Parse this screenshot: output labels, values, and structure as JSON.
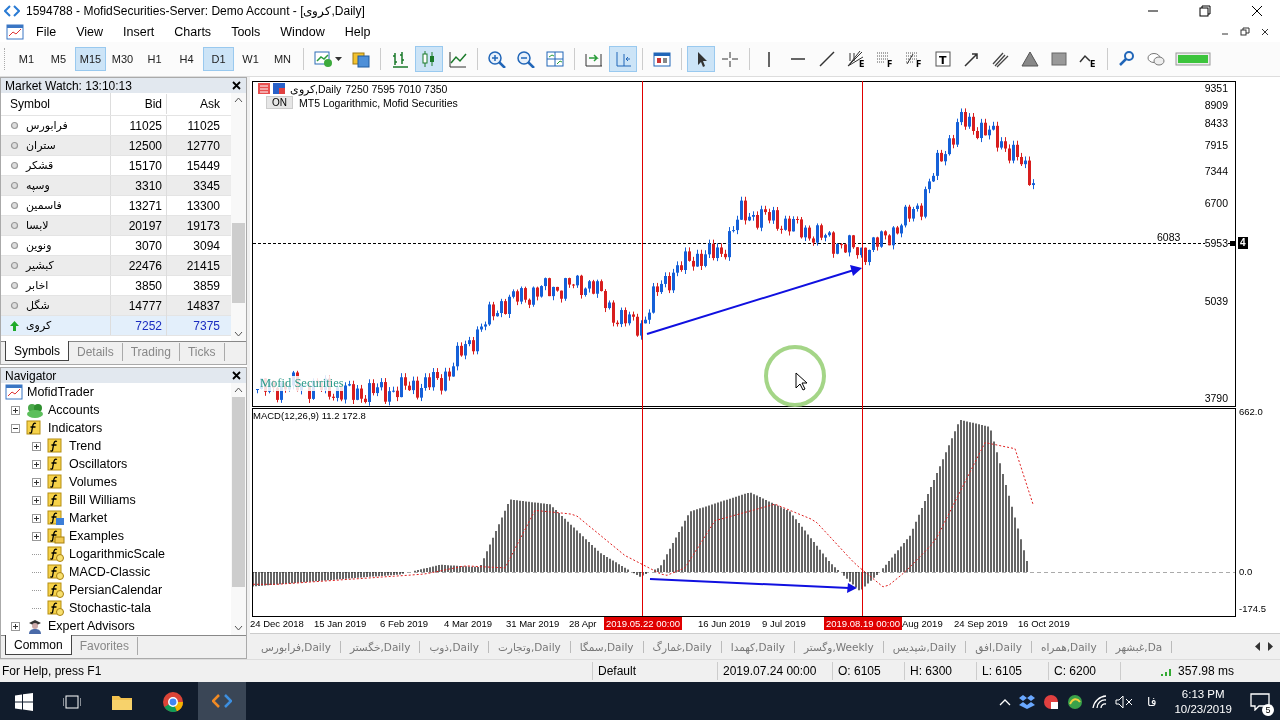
{
  "window": {
    "title": "1594788 - MofidSecurities-Server: Demo Account - [کروی,Daily]"
  },
  "menu": [
    "File",
    "View",
    "Insert",
    "Charts",
    "Tools",
    "Window",
    "Help"
  ],
  "timeframes": [
    {
      "label": "M1",
      "selected": false
    },
    {
      "label": "M5",
      "selected": false
    },
    {
      "label": "M15",
      "selected": true
    },
    {
      "label": "M30",
      "selected": false
    },
    {
      "label": "H1",
      "selected": false
    },
    {
      "label": "H4",
      "selected": false
    },
    {
      "label": "D1",
      "selected": true
    },
    {
      "label": "W1",
      "selected": false
    },
    {
      "label": "MN",
      "selected": false
    }
  ],
  "tools": [
    {
      "kind": "new-chart",
      "selected": false
    },
    {
      "kind": "profiles",
      "selected": false
    },
    {
      "kind": "bar-chart",
      "selected": false
    },
    {
      "kind": "candlestick",
      "selected": true
    },
    {
      "kind": "line-chart",
      "selected": false
    },
    {
      "kind": "zoom-in",
      "selected": false
    },
    {
      "kind": "zoom-out",
      "selected": false
    },
    {
      "kind": "tile",
      "selected": false
    },
    {
      "kind": "auto-scroll",
      "selected": false
    },
    {
      "kind": "chart-shift",
      "selected": true
    },
    {
      "kind": "templates",
      "selected": false
    },
    {
      "kind": "cursor",
      "selected": true
    },
    {
      "kind": "crosshair",
      "selected": false
    },
    {
      "kind": "vertical-line",
      "selected": false
    },
    {
      "kind": "horizontal-line",
      "selected": false
    },
    {
      "kind": "trend-line",
      "selected": false
    },
    {
      "kind": "fan",
      "selected": false,
      "letter": "E"
    },
    {
      "kind": "fibonacci",
      "selected": false,
      "letter": "F"
    },
    {
      "kind": "fibonacci-expansion",
      "selected": false,
      "letter": "F"
    },
    {
      "kind": "text",
      "selected": false,
      "letter": "T"
    },
    {
      "kind": "arrow",
      "selected": false
    },
    {
      "kind": "channel",
      "selected": false
    },
    {
      "kind": "triangle",
      "selected": false
    },
    {
      "kind": "rectangle",
      "selected": false
    },
    {
      "kind": "wave",
      "selected": false,
      "letter": "E"
    },
    {
      "kind": "search",
      "selected": false
    },
    {
      "kind": "chat",
      "selected": false
    },
    {
      "kind": "signal",
      "selected": false
    }
  ],
  "market_watch": {
    "title": "Market Watch: 13:10:13",
    "columns": [
      "Symbol",
      "Bid",
      "Ask"
    ],
    "rows": [
      {
        "symbol": "فرابورس",
        "bid": "11025",
        "ask": "11025",
        "up": false,
        "selected": false
      },
      {
        "symbol": "ستران",
        "bid": "12500",
        "ask": "12770",
        "up": false,
        "selected": false
      },
      {
        "symbol": "قشکر",
        "bid": "15170",
        "ask": "15449",
        "up": false,
        "selected": false
      },
      {
        "symbol": "وسپه",
        "bid": "3310",
        "ask": "3345",
        "up": false,
        "selected": false
      },
      {
        "symbol": "فاسمین",
        "bid": "13271",
        "ask": "13300",
        "up": false,
        "selected": false
      },
      {
        "symbol": "لابسا",
        "bid": "20197",
        "ask": "19173",
        "up": false,
        "selected": false
      },
      {
        "symbol": "ونوین",
        "bid": "3070",
        "ask": "3094",
        "up": false,
        "selected": false
      },
      {
        "symbol": "کبشیر",
        "bid": "22476",
        "ask": "21415",
        "up": false,
        "selected": false
      },
      {
        "symbol": "اخابر",
        "bid": "3850",
        "ask": "3859",
        "up": false,
        "selected": false
      },
      {
        "symbol": "شگل",
        "bid": "14777",
        "ask": "14837",
        "up": false,
        "selected": false
      },
      {
        "symbol": "کروی",
        "bid": "7252",
        "ask": "7375",
        "up": true,
        "selected": true
      }
    ],
    "tabs": [
      {
        "label": "Symbols",
        "selected": true
      },
      {
        "label": "Details",
        "selected": false
      },
      {
        "label": "Trading",
        "selected": false
      },
      {
        "label": "Ticks",
        "selected": false
      }
    ]
  },
  "navigator": {
    "title": "Navigator",
    "tree": [
      {
        "label": "MofidTrader",
        "kind": "root",
        "children": [
          {
            "label": "Accounts",
            "kind": "accounts",
            "expanded": false
          },
          {
            "label": "Indicators",
            "kind": "group",
            "expanded": true,
            "children": [
              {
                "label": "Trend",
                "kind": "group",
                "expanded": false
              },
              {
                "label": "Oscillators",
                "kind": "group",
                "expanded": false
              },
              {
                "label": "Volumes",
                "kind": "group",
                "expanded": false
              },
              {
                "label": "Bill Williams",
                "kind": "group",
                "expanded": false
              },
              {
                "label": "Market",
                "kind": "market",
                "expanded": false
              },
              {
                "label": "Examples",
                "kind": "examples",
                "expanded": false
              },
              {
                "label": "LogarithmicScale",
                "kind": "indicator"
              },
              {
                "label": "MACD-Classic",
                "kind": "indicator"
              },
              {
                "label": "PersianCalendar",
                "kind": "indicator"
              },
              {
                "label": "Stochastic-tala",
                "kind": "indicator"
              }
            ]
          },
          {
            "label": "Expert Advisors",
            "kind": "experts",
            "expanded": false
          }
        ]
      }
    ],
    "tabs": [
      {
        "label": "Common",
        "selected": true
      },
      {
        "label": "Favorites",
        "selected": false
      }
    ]
  },
  "chart": {
    "title": "کروی,Daily",
    "ohlc": "7250 7595 7010 7350",
    "indicator_button": "ON",
    "indicator_label": "MT5 Logarithmic, Mofid Securities",
    "overlay_text": "Mofid Securities",
    "price_labels": [
      "9351",
      "8909",
      "8433",
      "7915",
      "7344",
      "6700",
      "5953",
      "5039",
      "3790"
    ],
    "line_label": "6083",
    "line_badge": "4",
    "macd_label": "MACD(12,26,9) 11.2 172.8",
    "macd_labels": [
      "662.0",
      "0.0",
      "-174.5"
    ],
    "dates": [
      "24 Dec 2018",
      "15 Jan 2019",
      "6 Feb 2019",
      "4 Mar 2019",
      "31 Mar 2019",
      "28 Apr",
      "16 Jun 2019",
      "9 Jul 2019",
      "Aug 2019",
      "24 Sep 2019",
      "16 Oct 2019"
    ],
    "marker_dates": [
      "2019.05.22 00:00",
      "2019.08.19 00:00"
    ]
  },
  "chart_tabs": [
    {
      "label": "فرابورس,Daily",
      "selected": false
    },
    {
      "label": "خگستر,Daily",
      "selected": false
    },
    {
      "label": "ذوب,Daily",
      "selected": false
    },
    {
      "label": "وتجارت,Daily",
      "selected": false
    },
    {
      "label": "سمگا,Daily",
      "selected": false
    },
    {
      "label": "غمارگ,Daily",
      "selected": false
    },
    {
      "label": "کهمدا,Daily",
      "selected": false
    },
    {
      "label": "وگستر,Weekly",
      "selected": false
    },
    {
      "label": "شپدیس,Daily",
      "selected": false
    },
    {
      "label": "افق,Daily",
      "selected": false
    },
    {
      "label": "همراه,Daily",
      "selected": false
    },
    {
      "label": "غبشهر,Da",
      "selected": false
    }
  ],
  "status": {
    "help": "For Help, press F1",
    "profile": "Default",
    "time": "2019.07.24 00:00",
    "open": "O: 6105",
    "high": "H: 6300",
    "low": "L: 6105",
    "close": "C: 6200",
    "ping": "357.98 ms"
  },
  "taskbar": {
    "language": "فا",
    "time": "6:13 PM",
    "date": "10/23/2019",
    "notifications": "5"
  }
}
